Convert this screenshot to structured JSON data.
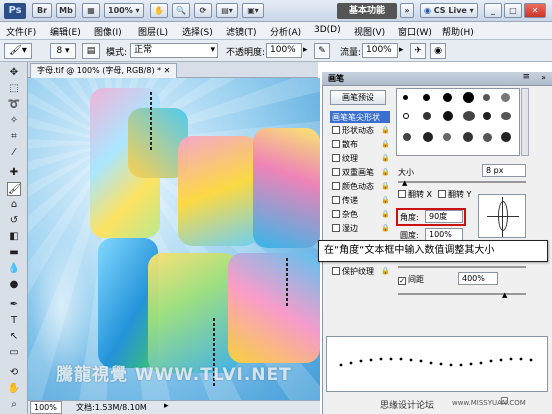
{
  "titlebar": {
    "logo": "Ps",
    "buttons": [
      "Br",
      "Mb"
    ],
    "zoom": "100%",
    "workspace": "基本功能",
    "cslive": "CS Live"
  },
  "menubar": {
    "items": [
      "文件(F)",
      "编辑(E)",
      "图像(I)",
      "图层(L)",
      "选择(S)",
      "滤镜(T)",
      "分析(A)",
      "3D(D)",
      "视图(V)",
      "窗口(W)",
      "帮助(H)"
    ]
  },
  "options": {
    "mode_label": "模式:",
    "mode_value": "正常",
    "opacity_label": "不透明度:",
    "opacity_value": "100%",
    "flow_label": "流量:",
    "flow_value": "100%"
  },
  "document": {
    "tab": "字母.tif @ 100% (字母, RGB/8) *",
    "zoom": "100%",
    "doc_info": "文档:1.53M/8.10M",
    "watermark": "騰龍視覺 WWW.TLVI.NET"
  },
  "brush_panel": {
    "title": "画笔",
    "preset_button": "画笔预设",
    "options": [
      {
        "label": "画笔笔尖形状",
        "checked": false,
        "selected": true,
        "locked": false
      },
      {
        "label": "形状动态",
        "checked": false,
        "selected": false,
        "locked": true
      },
      {
        "label": "散布",
        "checked": false,
        "selected": false,
        "locked": true
      },
      {
        "label": "纹理",
        "checked": false,
        "selected": false,
        "locked": true
      },
      {
        "label": "双重画笔",
        "checked": false,
        "selected": false,
        "locked": true
      },
      {
        "label": "颜色动态",
        "checked": false,
        "selected": false,
        "locked": true
      },
      {
        "label": "传递",
        "checked": false,
        "selected": false,
        "locked": true
      },
      {
        "label": "杂色",
        "checked": false,
        "selected": false,
        "locked": true
      },
      {
        "label": "湿边",
        "checked": false,
        "selected": false,
        "locked": true
      },
      {
        "label": "建立",
        "checked": false,
        "selected": false,
        "locked": true
      },
      {
        "label": "平滑",
        "checked": false,
        "selected": false,
        "locked": true
      },
      {
        "label": "保护纹理",
        "checked": false,
        "selected": false,
        "locked": true
      }
    ],
    "size_label": "大小",
    "size_value": "8 px",
    "flip_x": "翻转 X",
    "flip_y": "翻转 Y",
    "angle_label": "角度:",
    "angle_value": "90度",
    "roundness_label": "圆度:",
    "roundness_value": "100%",
    "spacing_label": "间距",
    "spacing_checked": true,
    "spacing_value": "400%"
  },
  "callout": "在“角度“文本框中输入数值调整其大小",
  "footer_brand": "思缘设计论坛",
  "footer_url": "www.MISSYUAN.COM",
  "colors": {
    "accent": "#cc1111",
    "panel_bg": "#f0f0f0",
    "canvas_bg": "#5fb3e4"
  }
}
